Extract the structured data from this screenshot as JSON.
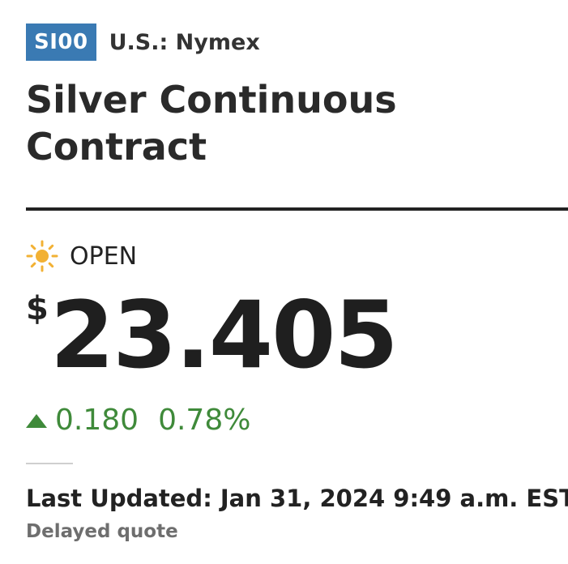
{
  "quote": {
    "ticker": "SI00",
    "exchange": "U.S.: Nymex",
    "name": "Silver Continuous Contract",
    "market_status": "OPEN",
    "market_status_icon": "sun-icon",
    "currency_symbol": "$",
    "price": "23.405",
    "change": "0.180",
    "change_percent": "0.78%",
    "change_direction": "up",
    "last_updated": "Last Updated: Jan 31, 2024 9:49 a.m. EST",
    "delay_note": "Delayed quote"
  },
  "colors": {
    "badge": "#3a7ab3",
    "positive": "#3f8a3a",
    "sun": "#f2b134",
    "text": "#222222",
    "muted": "#6e6e6e"
  }
}
